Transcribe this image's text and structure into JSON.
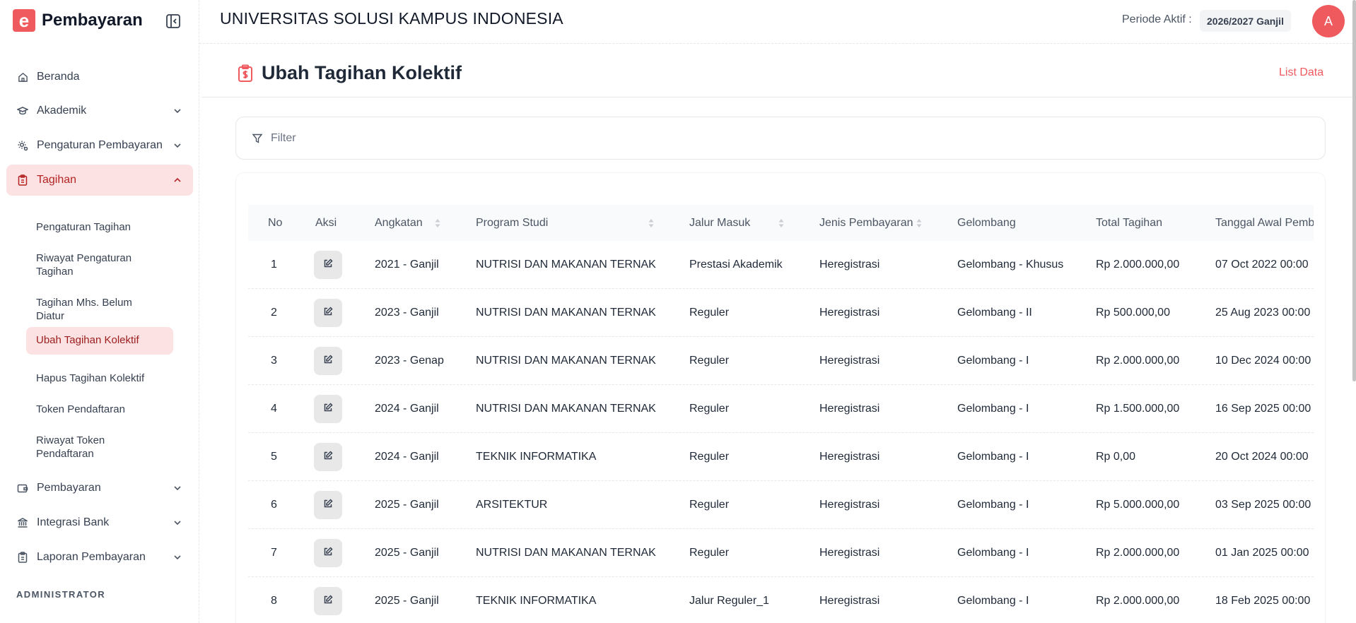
{
  "brand": {
    "logo_letter": "e",
    "name": "Pembayaran"
  },
  "sidebar": {
    "items": [
      {
        "label": "Beranda",
        "icon": "home-icon"
      },
      {
        "label": "Akademik",
        "icon": "graduation-cap-icon"
      },
      {
        "label": "Pengaturan Pembayaran",
        "icon": "settings-icon"
      },
      {
        "label": "Tagihan",
        "icon": "clipboard-icon"
      },
      {
        "label": "Pembayaran",
        "icon": "wallet-icon"
      },
      {
        "label": "Integrasi Bank",
        "icon": "bank-icon"
      },
      {
        "label": "Laporan Pembayaran",
        "icon": "clipboard-list-icon"
      }
    ],
    "subitems": [
      "Pengaturan Tagihan",
      "Riwayat Pengaturan Tagihan",
      "Tagihan Mhs. Belum Diatur",
      "Ubah Tagihan Kolektif",
      "Hapus Tagihan Kolektif",
      "Token Pendaftaran",
      "Riwayat Token Pendaftaran"
    ],
    "section_label": "ADMINISTRATOR"
  },
  "header": {
    "university": "UNIVERSITAS SOLUSI KAMPUS INDONESIA",
    "periode_label": "Periode Aktif :",
    "periode_value": "2026/2027 Ganjil",
    "avatar_initial": "A"
  },
  "page": {
    "title": "Ubah Tagihan Kolektif",
    "list_link": "List Data",
    "filter_label": "Filter"
  },
  "table": {
    "columns": [
      "No",
      "Aksi",
      "Angkatan",
      "Program Studi",
      "Jalur Masuk",
      "Jenis Pembayaran",
      "Gelombang",
      "Total Tagihan",
      "Tanggal Awal Pembayaran"
    ],
    "rows": [
      {
        "no": "1",
        "angkatan": "2021 - Ganjil",
        "prodi": "NUTRISI DAN MAKANAN TERNAK",
        "jalur": "Prestasi Akademik",
        "jenis": "Heregistrasi",
        "gelombang": "Gelombang - Khusus",
        "total": "Rp 2.000.000,00",
        "tanggal": "07 Oct 2022 00:00"
      },
      {
        "no": "2",
        "angkatan": "2023 - Ganjil",
        "prodi": "NUTRISI DAN MAKANAN TERNAK",
        "jalur": "Reguler",
        "jenis": "Heregistrasi",
        "gelombang": "Gelombang - II",
        "total": "Rp 500.000,00",
        "tanggal": "25 Aug 2023 00:00"
      },
      {
        "no": "3",
        "angkatan": "2023 - Genap",
        "prodi": "NUTRISI DAN MAKANAN TERNAK",
        "jalur": "Reguler",
        "jenis": "Heregistrasi",
        "gelombang": "Gelombang - I",
        "total": "Rp 2.000.000,00",
        "tanggal": "10 Dec 2024 00:00"
      },
      {
        "no": "4",
        "angkatan": "2024 - Ganjil",
        "prodi": "NUTRISI DAN MAKANAN TERNAK",
        "jalur": "Reguler",
        "jenis": "Heregistrasi",
        "gelombang": "Gelombang - I",
        "total": "Rp 1.500.000,00",
        "tanggal": "16 Sep 2025 00:00"
      },
      {
        "no": "5",
        "angkatan": "2024 - Ganjil",
        "prodi": "TEKNIK INFORMATIKA",
        "jalur": "Reguler",
        "jenis": "Heregistrasi",
        "gelombang": "Gelombang - I",
        "total": "Rp 0,00",
        "tanggal": "20 Oct 2024 00:00"
      },
      {
        "no": "6",
        "angkatan": "2025 - Ganjil",
        "prodi": "ARSITEKTUR",
        "jalur": "Reguler",
        "jenis": "Heregistrasi",
        "gelombang": "Gelombang - I",
        "total": "Rp 5.000.000,00",
        "tanggal": "03 Sep 2025 00:00"
      },
      {
        "no": "7",
        "angkatan": "2025 - Ganjil",
        "prodi": "NUTRISI DAN MAKANAN TERNAK",
        "jalur": "Reguler",
        "jenis": "Heregistrasi",
        "gelombang": "Gelombang - I",
        "total": "Rp 2.000.000,00",
        "tanggal": "01 Jan 2025 00:00"
      },
      {
        "no": "8",
        "angkatan": "2025 - Ganjil",
        "prodi": "TEKNIK INFORMATIKA",
        "jalur": "Jalur Reguler_1",
        "jenis": "Heregistrasi",
        "gelombang": "Gelombang - I",
        "total": "Rp 2.000.000,00",
        "tanggal": "18 Feb 2025 00:00"
      }
    ]
  },
  "colors": {
    "accent": "#ef5a5f",
    "active_bg": "#fde2e3"
  }
}
